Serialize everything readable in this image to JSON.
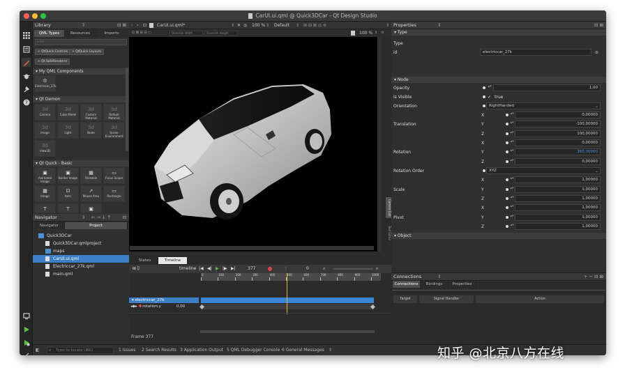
{
  "window": {
    "title": "CarUI.ui.qml @ Quick3DCar - Qt Design Studio"
  },
  "library": {
    "title": "Library",
    "tabs": [
      "QML Types",
      "Resources",
      "Imports"
    ],
    "filter_placeholder": "Filter",
    "add_buttons": [
      "QtQuick.Controls",
      "QtQuick.Layouts",
      "Qt.SafeRenderer"
    ],
    "sections": {
      "my_components": "My QML Components",
      "qt_demon": "Qt Demon",
      "qt_quick_basic": "Qt Quick - Basic"
    },
    "my_components": [
      "Electriccar_27k"
    ],
    "qt_demon_items": [
      "Camera",
      "Cube Model",
      "Custom Material",
      "Default Material",
      "Image",
      "Light",
      "Node",
      "Scene Environment",
      "View3D"
    ],
    "qt_quick_items": [
      "Animated Image",
      "Border Image",
      "Flickable",
      "Focus Scope",
      "Image",
      "Item",
      "Mouse Area",
      "Rectangle"
    ],
    "tile_glyph": "3d"
  },
  "navigator": {
    "title": "Navigator",
    "tabs": [
      "Navigator",
      "Project"
    ],
    "tree": [
      {
        "label": "Quick3DCar",
        "indent": 0
      },
      {
        "label": "Quick3DCar.qmlproject",
        "indent": 1
      },
      {
        "label": "maps",
        "indent": 1
      },
      {
        "label": "CarUI.ui.qml",
        "indent": 1
      },
      {
        "label": "Electriccar_27k.qml",
        "indent": 1
      },
      {
        "label": "main.qml",
        "indent": 1
      }
    ]
  },
  "editor": {
    "file": "CarUI.ui.qml*",
    "zoom": "100 %",
    "style": "Default",
    "override_width": "Override Width",
    "override_height": "Override Height",
    "zoom2": "100 %",
    "side_labels": [
      "Camera Edit",
      "Text Editor"
    ]
  },
  "timeline": {
    "tabs": [
      "States",
      "Timeline"
    ],
    "label": "timeline",
    "current_frame": "377",
    "zero": "0",
    "ticks": [
      "0",
      "100",
      "200",
      "300",
      "400",
      "500",
      "600",
      "700",
      "800",
      "900",
      "1000"
    ],
    "tracks": [
      {
        "label": "electriccar_27k",
        "value": ""
      },
      {
        "label": "rotation.y",
        "value": "0,00"
      }
    ],
    "frame_label": "Frame 377"
  },
  "properties": {
    "title": "Properties",
    "sections": {
      "type": "Type",
      "node": "Node",
      "object": "Object"
    },
    "type_label": "Type",
    "id_label": "id",
    "id_value": "electriccar_27k",
    "opacity_label": "Opacity",
    "opacity_value": "1,00",
    "visible_label": "is Visible",
    "visible_value": "true",
    "orientation_label": "Orientation",
    "orientation_value": "RightHanded",
    "translation_label": "Translation",
    "translation": {
      "x": "0,00000",
      "y": "-100,00000",
      "z": "100,00000"
    },
    "rotation_label": "Rotation",
    "rotation": {
      "x": "0,00000",
      "y": "360,00000",
      "z": "0,00000"
    },
    "rotation_order_label": "Rotation Order",
    "rotation_order_value": "XYZ",
    "scale_label": "Scale",
    "scale": {
      "x": "1,00000",
      "y": "1,00000",
      "z": "1,00000"
    },
    "pivot_label": "Pivot",
    "pivot": {
      "x": "1,00000",
      "y": "1,00000",
      "z": "1,00000"
    },
    "axes": {
      "x": "X",
      "y": "Y",
      "z": "Z"
    }
  },
  "connections": {
    "title": "Connections",
    "tabs": [
      "Connections",
      "Bindings",
      "Properties"
    ],
    "columns": [
      "Target",
      "Signal Handler",
      "Action"
    ]
  },
  "statusbar": {
    "locate_placeholder": "Type to locate (⌘K)",
    "items": [
      "1 Issues",
      "2 Search Results",
      "3 Application Output",
      "5 QML Debugger Console",
      "6 General Messages"
    ]
  },
  "watermark": "知乎 @北京八方在线",
  "colors": {
    "accent": "#4a90d9",
    "highlight": "#3d7fc4",
    "timeline_bar": "#3a86d4",
    "playhead": "#e8b33a",
    "record": "#e04848",
    "sidebar_active": "#e07040",
    "run": "#5fbf3f"
  }
}
